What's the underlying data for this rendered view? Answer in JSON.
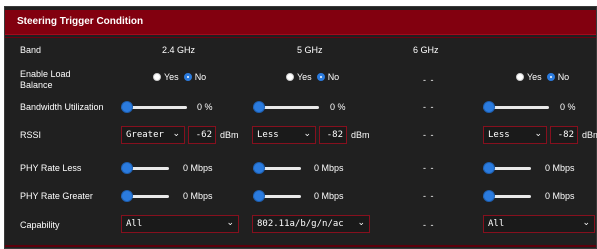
{
  "section": {
    "title": "Steering Trigger Condition"
  },
  "band_row": {
    "label": "Band",
    "bands": [
      "2.4 GHz",
      "5 GHz",
      "6 GHz"
    ]
  },
  "load_balance": {
    "label_line1": "Enable Load",
    "label_line2": "Balance",
    "yes": "Yes",
    "no": "No",
    "selected": "No",
    "dash": "- -"
  },
  "bandwidth": {
    "label": "Bandwidth Utilization",
    "value": "0 %",
    "level": 0,
    "dash": "- -"
  },
  "rssi": {
    "label": "RSSI",
    "unit": "dBm",
    "dash": "- -",
    "col1": {
      "op": "Greater",
      "value": "-62"
    },
    "col2": {
      "op": "Less",
      "value": "-82"
    },
    "col4": {
      "op": "Less",
      "value": "-82"
    }
  },
  "phy_less": {
    "label": "PHY Rate Less",
    "value": "0 Mbps",
    "level": 0,
    "dash": "- -"
  },
  "phy_greater": {
    "label": "PHY Rate Greater",
    "value": "0 Mbps",
    "level": 0,
    "dash": "- -"
  },
  "capability": {
    "label": "Capability",
    "dash": "- -",
    "col1": "All",
    "col2": "802.11a/b/g/n/ac",
    "col4": "All"
  },
  "colors": {
    "header": "#82000f",
    "panel": "#202020",
    "accent": "#2b7bde",
    "select_border": "#86101e"
  }
}
